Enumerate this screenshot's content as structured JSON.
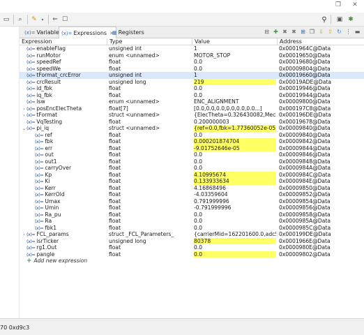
{
  "toolbar": {
    "icons": [
      "terminal-icon",
      "search-icon",
      "perspective-icon"
    ]
  },
  "tabs": [
    {
      "label": "Variables",
      "icon": "(x)=",
      "active": false
    },
    {
      "label": "Expressions",
      "icon": "(x)=",
      "active": true,
      "close": "✕"
    },
    {
      "label": "Registers",
      "icon": "▦",
      "active": false
    }
  ],
  "table": {
    "headers": {
      "expression": "Expression",
      "type": "Type",
      "value": "Value",
      "address": "Address"
    },
    "rows": [
      {
        "indent": 0,
        "twisty": "",
        "name": "enableFlag",
        "type": "unsigned int",
        "value": "1",
        "address": "0x0001964C@Data",
        "highlight": false,
        "selected": false
      },
      {
        "indent": 0,
        "twisty": "",
        "name": "runMotor",
        "type": "enum <unnamed>",
        "value": "MOTOR_STOP",
        "address": "0x00019650@Data",
        "highlight": false,
        "selected": false
      },
      {
        "indent": 0,
        "twisty": "",
        "name": "speedRef",
        "type": "float",
        "value": "0.0",
        "address": "0x00019680@Data",
        "highlight": false,
        "selected": false
      },
      {
        "indent": 0,
        "twisty": "",
        "name": "speedWe",
        "type": "float",
        "value": "0.0",
        "address": "0x00009804@Data",
        "highlight": false,
        "selected": false
      },
      {
        "indent": 0,
        "twisty": "",
        "name": "tFormat_crcError",
        "type": "unsigned int",
        "value": "1",
        "address": "0x00019660@Data",
        "highlight": false,
        "selected": true
      },
      {
        "indent": 0,
        "twisty": "",
        "name": "crcResult",
        "type": "unsigned long",
        "value": "219",
        "address": "0x00019ADE@Data",
        "highlight": true,
        "selected": false
      },
      {
        "indent": 0,
        "twisty": "",
        "name": "id_fbk",
        "type": "float",
        "value": "0.0",
        "address": "0x00019946@Data",
        "highlight": false,
        "selected": false
      },
      {
        "indent": 0,
        "twisty": "",
        "name": "iq_fbk",
        "type": "float",
        "value": "0.0",
        "address": "0x00019944@Data",
        "highlight": false,
        "selected": false
      },
      {
        "indent": 0,
        "twisty": "",
        "name": "lsw",
        "type": "enum <unnamed>",
        "value": "ENC_ALIGNMENT",
        "address": "0x00009800@Data",
        "highlight": false,
        "selected": false
      },
      {
        "indent": 0,
        "twisty": "›",
        "name": "posEncElecTheta",
        "type": "float[7]",
        "value": "[0.0,0.0,0.0,0.0,0.0,0.0...]",
        "address": "0x000197C8@Data",
        "highlight": false,
        "selected": false
      },
      {
        "indent": 0,
        "twisty": "›",
        "name": "tFormat",
        "type": "struct <unnamed>",
        "value": "{ElecTheta=0.326430082,MechT...",
        "address": "0x000196DE@Data",
        "highlight": false,
        "selected": false
      },
      {
        "indent": 0,
        "twisty": "",
        "name": "VqTesting",
        "type": "float",
        "value": "0.200000003",
        "address": "0x00019678@Data",
        "highlight": false,
        "selected": false
      },
      {
        "indent": 0,
        "twisty": "⌄",
        "name": "pi_iq",
        "type": "struct <unnamed>",
        "value": "{ref=0.0,fbk=1.77360052e-05,er...",
        "address": "0x00009840@Data",
        "highlight": true,
        "selected": false
      },
      {
        "indent": 1,
        "twisty": "",
        "name": "ref",
        "type": "float",
        "value": "0.0",
        "address": "0x00009840@Data",
        "highlight": false,
        "selected": false
      },
      {
        "indent": 1,
        "twisty": "",
        "name": "fbk",
        "type": "float",
        "value": "0.000201874704",
        "address": "0x00009842@Data",
        "highlight": true,
        "selected": false
      },
      {
        "indent": 1,
        "twisty": "",
        "name": "err",
        "type": "float",
        "value": "-9.01752646e-05",
        "address": "0x00009844@Data",
        "highlight": true,
        "selected": false
      },
      {
        "indent": 1,
        "twisty": "",
        "name": "out",
        "type": "float",
        "value": "0.0",
        "address": "0x00009846@Data",
        "highlight": false,
        "selected": false
      },
      {
        "indent": 1,
        "twisty": "",
        "name": "out1",
        "type": "float",
        "value": "0.0",
        "address": "0x00009848@Data",
        "highlight": false,
        "selected": false
      },
      {
        "indent": 1,
        "twisty": "",
        "name": "carryOver",
        "type": "float",
        "value": "0.0",
        "address": "0x0000984A@Data",
        "highlight": false,
        "selected": false
      },
      {
        "indent": 1,
        "twisty": "",
        "name": "Kp",
        "type": "float",
        "value": "4.10995674",
        "address": "0x0000984C@Data",
        "highlight": true,
        "selected": false
      },
      {
        "indent": 1,
        "twisty": "",
        "name": "Ki",
        "type": "float",
        "value": "0.133933634",
        "address": "0x0000984E@Data",
        "highlight": true,
        "selected": false
      },
      {
        "indent": 1,
        "twisty": "",
        "name": "Kerr",
        "type": "float",
        "value": "4.16868496",
        "address": "0x00009850@Data",
        "highlight": false,
        "selected": false
      },
      {
        "indent": 1,
        "twisty": "",
        "name": "KerrOld",
        "type": "float",
        "value": "-4.03359604",
        "address": "0x00009852@Data",
        "highlight": false,
        "selected": false
      },
      {
        "indent": 1,
        "twisty": "",
        "name": "Umax",
        "type": "float",
        "value": "0.791999996",
        "address": "0x00009854@Data",
        "highlight": false,
        "selected": false
      },
      {
        "indent": 1,
        "twisty": "",
        "name": "Umin",
        "type": "float",
        "value": "-0.791999996",
        "address": "0x00009856@Data",
        "highlight": false,
        "selected": false
      },
      {
        "indent": 1,
        "twisty": "",
        "name": "Ra_pu",
        "type": "float",
        "value": "0.0",
        "address": "0x00009858@Data",
        "highlight": false,
        "selected": false
      },
      {
        "indent": 1,
        "twisty": "",
        "name": "Ra",
        "type": "float",
        "value": "0.0",
        "address": "0x0000985A@Data",
        "highlight": false,
        "selected": false
      },
      {
        "indent": 1,
        "twisty": "",
        "name": "fbk1",
        "type": "float",
        "value": "0.0",
        "address": "0x0000985C@Data",
        "highlight": false,
        "selected": false
      },
      {
        "indent": 0,
        "twisty": "›",
        "name": "FCL_params",
        "type": "struct _FCL_Parameters_",
        "value": "{carrierMid=162201600.0,adcSc...",
        "address": "0x000199DE@Data",
        "highlight": false,
        "selected": false
      },
      {
        "indent": 0,
        "twisty": "",
        "name": "isrTicker",
        "type": "unsigned long",
        "value": "80378",
        "address": "0x0001966E@Data",
        "highlight": true,
        "selected": false
      },
      {
        "indent": 0,
        "twisty": "",
        "name": "rg1.Out",
        "type": "float",
        "value": "0.0",
        "address": "0x0000980E@Data",
        "highlight": false,
        "selected": false
      },
      {
        "indent": 0,
        "twisty": "",
        "name": "pangle",
        "type": "float",
        "value": "0.0",
        "address": "0x00009802@Data",
        "highlight": true,
        "selected": false
      }
    ],
    "add_new": "Add new expression"
  },
  "status": {
    "text": "70 0xd9c3"
  },
  "colors": {
    "highlight": "#ffff66",
    "selected": "#d9e8fb",
    "var_icon": "#2a4f8a"
  }
}
